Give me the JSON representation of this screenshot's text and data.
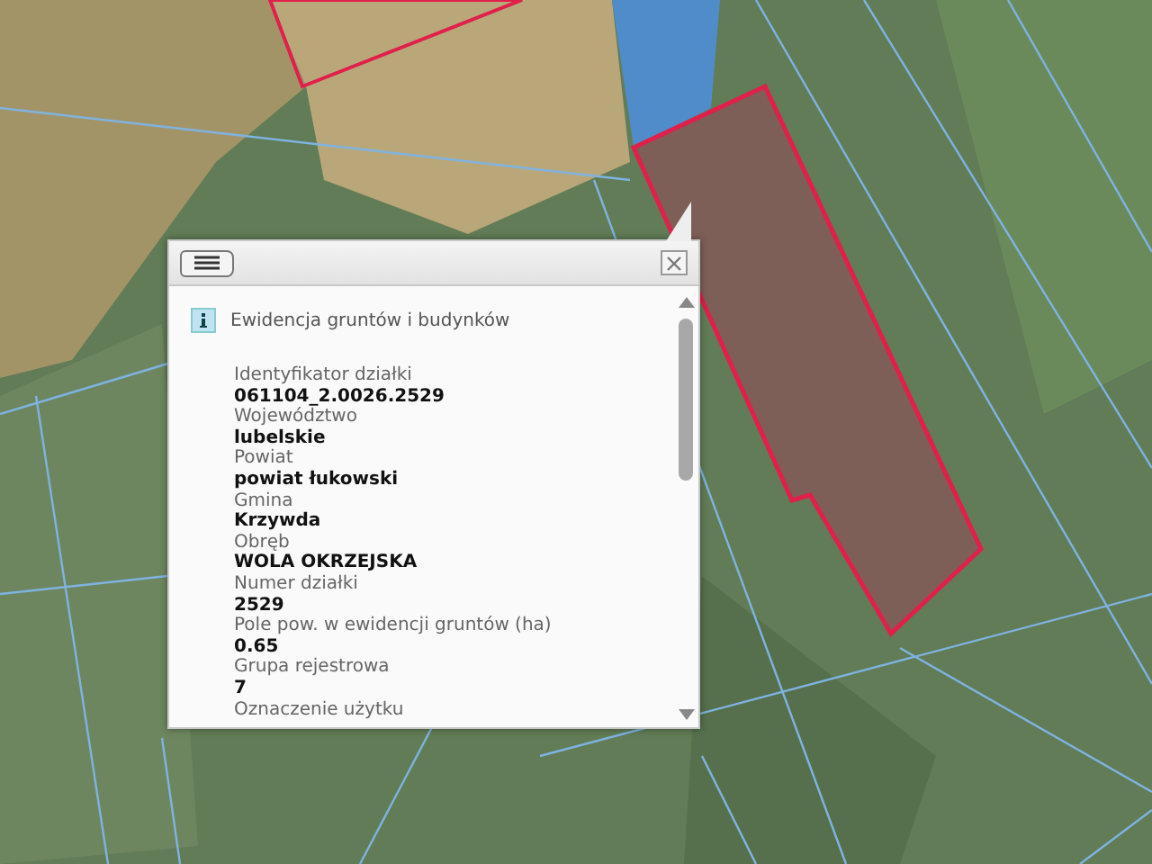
{
  "map": {
    "selected_parcel": true
  },
  "popup": {
    "title": "Ewidencja gruntów i budynków",
    "fields": [
      {
        "label": "Identyfikator działki",
        "value": "061104_2.0026.2529"
      },
      {
        "label": "Województwo",
        "value": "lubelskie"
      },
      {
        "label": "Powiat",
        "value": "powiat łukowski"
      },
      {
        "label": "Gmina",
        "value": "Krzywda"
      },
      {
        "label": "Obręb",
        "value": "WOLA OKRZEJSKA"
      },
      {
        "label": "Numer działki",
        "value": "2529"
      },
      {
        "label": "Pole pow. w ewidencji gruntów (ha)",
        "value": "0.65"
      },
      {
        "label": "Grupa rejestrowa",
        "value": "7"
      },
      {
        "label": "Oznaczenie użytku"
      }
    ]
  }
}
